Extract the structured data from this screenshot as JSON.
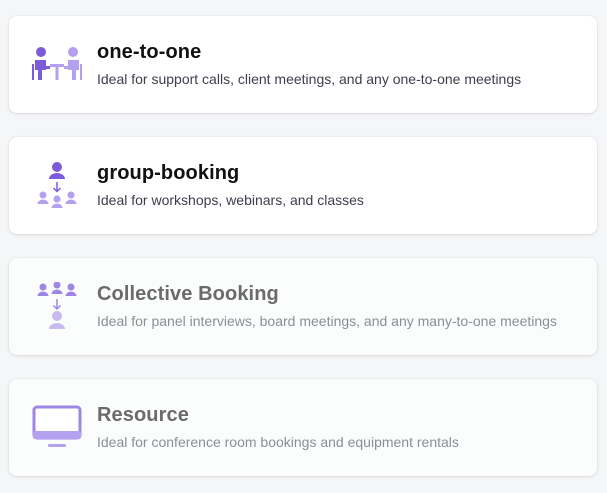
{
  "colors": {
    "accent": "#7c5cdb",
    "accent_light": "#b3a0ee",
    "accent_faded": "#bfb0ef"
  },
  "event_types": [
    {
      "title": "one-to-one",
      "description": "Ideal for support calls, client meetings, and any one-to-one meetings",
      "icon": "one-to-one-icon",
      "enabled": true
    },
    {
      "title": "group-booking",
      "description": "Ideal for workshops, webinars, and classes",
      "icon": "group-booking-icon",
      "enabled": true
    },
    {
      "title": "Collective Booking",
      "description": "Ideal for panel interviews, board meetings, and any many-to-one meetings",
      "icon": "collective-booking-icon",
      "enabled": false
    },
    {
      "title": "Resource",
      "description": "Ideal for conference room bookings and equipment rentals",
      "icon": "monitor-icon",
      "enabled": false
    }
  ]
}
